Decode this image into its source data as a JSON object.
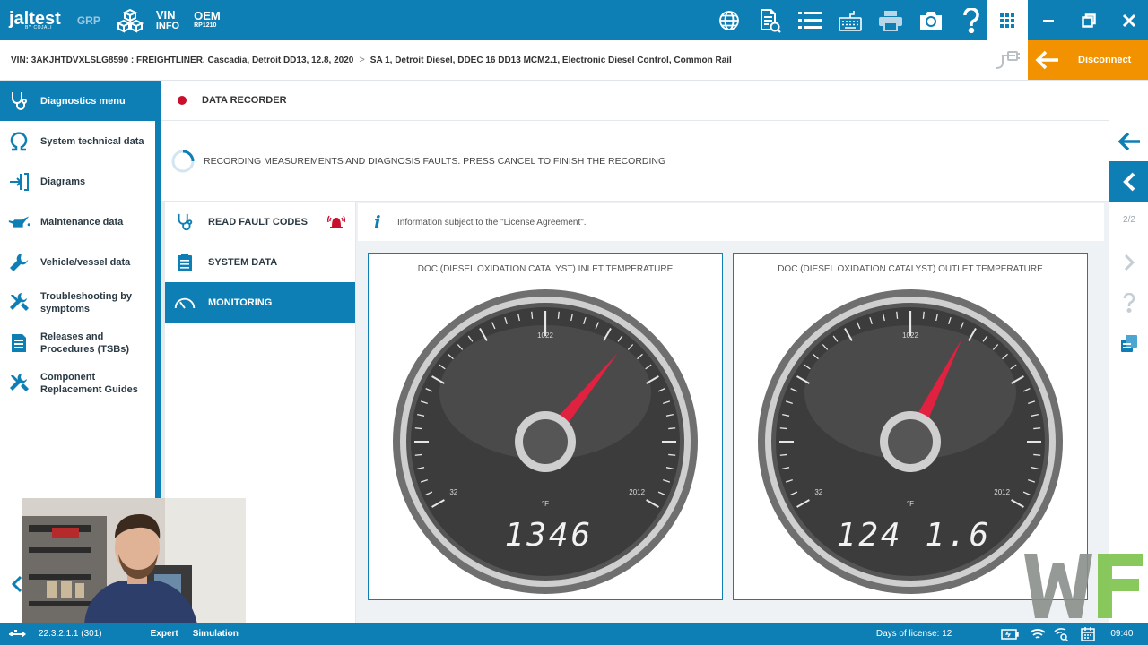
{
  "brand": {
    "logo": "jaltest",
    "logo_sub": "BY COJALI",
    "grp": "GRP",
    "vin_info_1": "VIN",
    "vin_info_2": "INFO",
    "oem_1": "OEM",
    "oem_2": "RP1210"
  },
  "toolbar": {
    "icons": [
      "globe-icon",
      "document-icon",
      "list-icon",
      "keyboard-icon",
      "printer-icon",
      "camera-icon",
      "help-icon",
      "apps-grid-icon"
    ]
  },
  "window": {
    "controls": [
      "minimize-icon",
      "restore-icon",
      "close-icon"
    ]
  },
  "vehicle": {
    "vin_text": "VIN: 3AKJHTDVXLSLG8590 : FREIGHTLINER, Cascadia, Detroit DD13, 12.8, 2020",
    "separator": ">",
    "system_text": "SA 1, Detroit Diesel, DDEC 16 DD13 MCM2.1, Electronic Diesel Control, Common Rail"
  },
  "disconnect": {
    "label": "Disconnect"
  },
  "sidebar": {
    "items": [
      {
        "label": "Diagnostics menu",
        "icon": "stethoscope-icon"
      },
      {
        "label": "System technical data",
        "icon": "omega-icon"
      },
      {
        "label": "Diagrams",
        "icon": "diagram-icon"
      },
      {
        "label": "Maintenance data",
        "icon": "oil-can-icon"
      },
      {
        "label": "Vehicle/vessel data",
        "icon": "wrench-icon"
      },
      {
        "label": "Troubleshooting by",
        "label2": "symptoms",
        "icon": "tools-icon"
      },
      {
        "label": "Releases and",
        "label2": "Procedures (TSBs)",
        "icon": "document-icon"
      },
      {
        "label": "Component",
        "label2": "Replacement Guides",
        "icon": "tools-icon"
      }
    ]
  },
  "recorder": {
    "title": "DATA RECORDER",
    "status": "RECORDING MEASUREMENTS AND DIAGNOSIS FAULTS. PRESS CANCEL TO FINISH THE RECORDING"
  },
  "submenu": {
    "items": [
      {
        "label": "READ FAULT CODES",
        "icon": "stethoscope-icon"
      },
      {
        "label": "SYSTEM DATA",
        "icon": "clipboard-icon"
      },
      {
        "label": "MONITORING",
        "icon": "gauge-icon"
      }
    ]
  },
  "info": {
    "text": "Information subject to the \"License Agreement\"."
  },
  "gauges": [
    {
      "title": "DOC (DIESEL OXIDATION CATALYST) INLET TEMPERATURE",
      "unit": "°F",
      "min_label": "32",
      "mid_label": "1022",
      "max_label": "2012",
      "readout": "1346",
      "value": 1346,
      "min": 32,
      "max": 2012
    },
    {
      "title": "DOC (DIESEL OXIDATION CATALYST) OUTLET TEMPERATURE",
      "unit": "°F",
      "min_label": "32",
      "mid_label": "1022",
      "max_label": "2012",
      "readout": "124 1.6",
      "value": 1241.6,
      "min": 32,
      "max": 2012
    }
  ],
  "rail": {
    "page": "2/2"
  },
  "status": {
    "version": "22.3.2.1.1 (301)",
    "mode": "Expert",
    "sim": "Simulation",
    "license": "Days of license: 12",
    "time": "09:40"
  },
  "colors": {
    "brand_blue": "#0e7fb5",
    "orange": "#f39200",
    "needle": "#e0213f",
    "record": "#c8102e"
  }
}
